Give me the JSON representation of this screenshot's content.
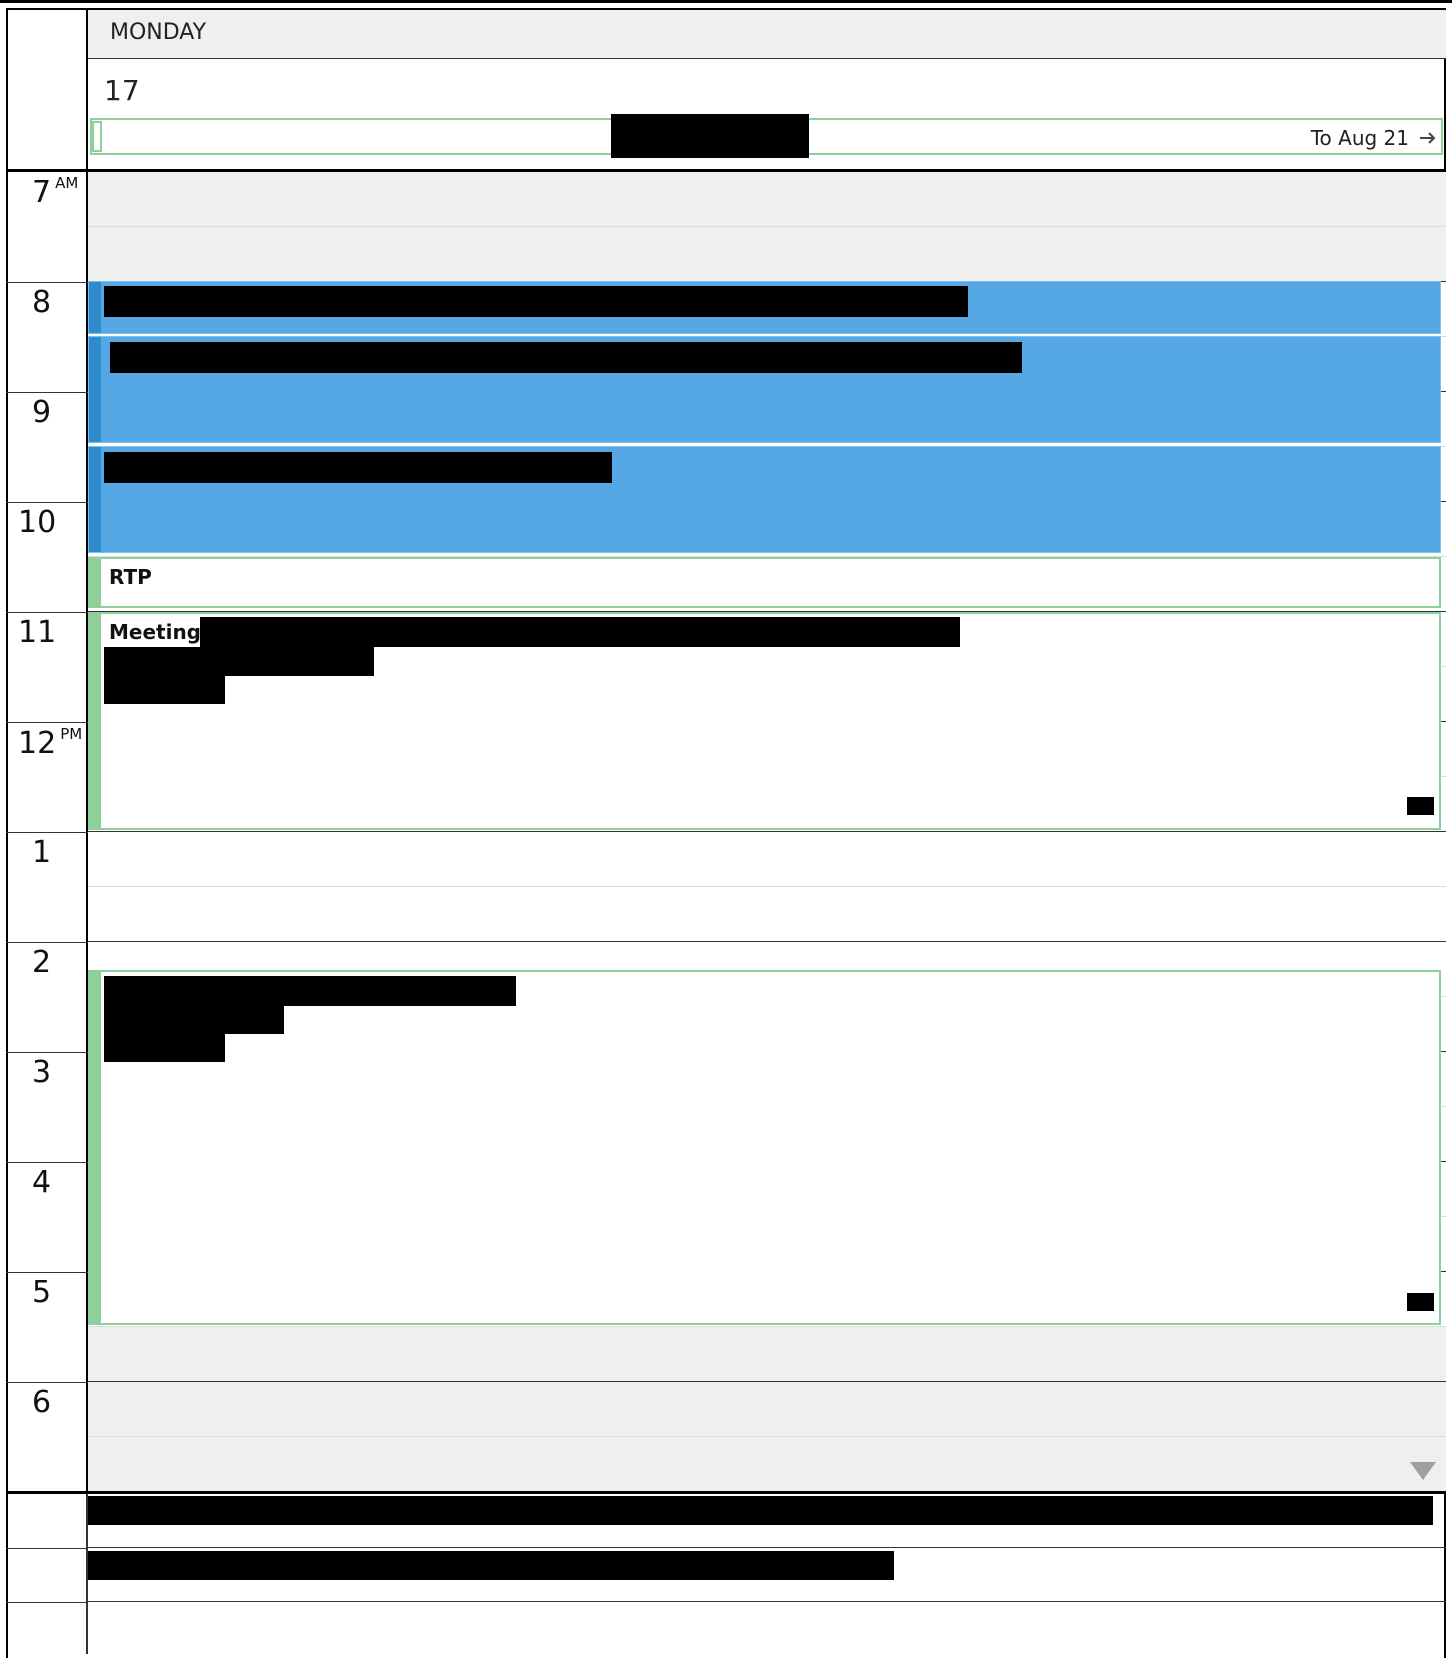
{
  "header": {
    "day_name": "MONDAY",
    "day_number": "17",
    "all_day_event": {
      "continues_label": "To Aug 21",
      "arrow_icon": "arrow-right-icon"
    }
  },
  "time_labels": [
    {
      "hour": "7",
      "suffix": "AM"
    },
    {
      "hour": "8",
      "suffix": ""
    },
    {
      "hour": "9",
      "suffix": ""
    },
    {
      "hour": "10",
      "suffix": ""
    },
    {
      "hour": "11",
      "suffix": ""
    },
    {
      "hour": "12",
      "suffix": "PM"
    },
    {
      "hour": "1",
      "suffix": ""
    },
    {
      "hour": "2",
      "suffix": ""
    },
    {
      "hour": "3",
      "suffix": ""
    },
    {
      "hour": "4",
      "suffix": ""
    },
    {
      "hour": "5",
      "suffix": ""
    },
    {
      "hour": "6",
      "suffix": ""
    }
  ],
  "events": {
    "rtp": {
      "label": "RTP"
    },
    "meeting": {
      "label": "Meeting:"
    }
  },
  "colors": {
    "event_blue": "#55a8e3",
    "event_blue_bar": "#2f8ccc",
    "event_green_border": "#8fd09a",
    "off_hours": "#efefef"
  }
}
